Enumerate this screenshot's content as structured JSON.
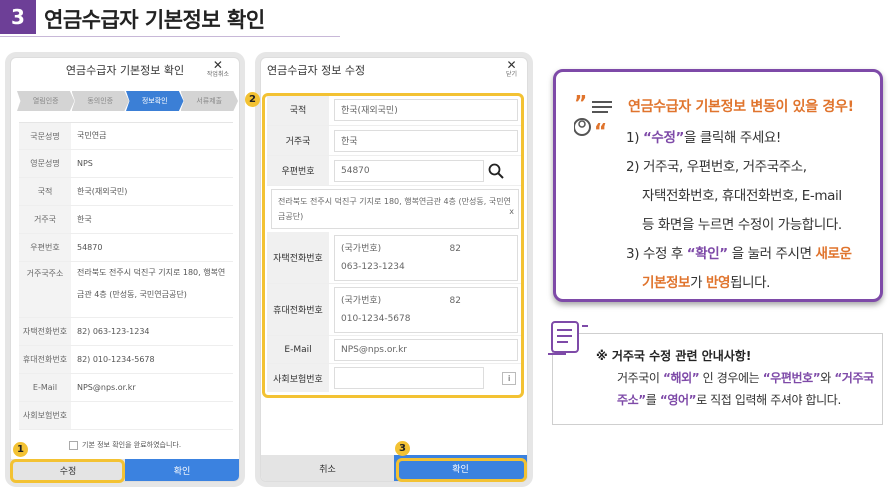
{
  "header": {
    "step_number": "3",
    "title": "연금수급자 기본정보 확인"
  },
  "screen1": {
    "title": "연금수급자 기본정보 확인",
    "close_label": "작업취소",
    "steps": [
      "열림인증",
      "동의인증",
      "정보확인",
      "서류제출"
    ],
    "rows": [
      {
        "label": "국문성명",
        "value": "국민연금"
      },
      {
        "label": "영문성명",
        "value": "NPS"
      },
      {
        "label": "국적",
        "value": "한국(재외국민)"
      },
      {
        "label": "거주국",
        "value": "한국"
      },
      {
        "label": "우편번호",
        "value": "54870"
      },
      {
        "label": "거주국주소",
        "value": "전라북도 전주시 덕진구 기지로 180, 행복연금관 4층 (만성동, 국민연금공단)"
      },
      {
        "label": "자택전화번호",
        "value": "82) 063-123-1234"
      },
      {
        "label": "휴대전화번호",
        "value": "82) 010-1234-5678"
      },
      {
        "label": "E-Mail",
        "value": "NPS@nps.or.kr"
      },
      {
        "label": "사회보험번호",
        "value": ""
      }
    ],
    "confirm_text": "기본 정보 확인을 완료하였습니다.",
    "edit_button": "수정",
    "ok_button": "확인"
  },
  "screen2": {
    "title": "연금수급자 정보 수정",
    "close_label": "닫기",
    "nationality_label": "국적",
    "nationality_value": "한국(재외국민)",
    "country_label": "거주국",
    "country_value": "한국",
    "zip_label": "우편번호",
    "zip_value": "54870",
    "address_value": "전라북도 전주시 덕진구 기지로 180, 행복연금관 4층 (만성동, 국민연금공단)",
    "home_phone_label": "자택전화번호",
    "home_phone_code_label": "(국가번호)",
    "home_phone_code": "82",
    "home_phone_value": "063-123-1234",
    "mobile_label": "휴대전화번호",
    "mobile_code_label": "(국가번호)",
    "mobile_code": "82",
    "mobile_value": "010-1234-5678",
    "email_label": "E-Mail",
    "email_value": "NPS@nps.or.kr",
    "ssn_label": "사회보험번호",
    "cancel_button": "취소",
    "ok_button": "확인"
  },
  "markers": [
    "1",
    "2",
    "3"
  ],
  "info_panel": {
    "heading": "연금수급자 기본정보 변동이 있을 경우!",
    "line1_pre": "1) ",
    "line1_hl": "“수정”",
    "line1_post": "을 클릭해 주세요!",
    "line2": "2) 거주국, 우편번호, 거주국주소,",
    "line3": "자택전화번호, 휴대전화번호, E-mail",
    "line4": "등 화면을 누르면 수정이 가능합니다.",
    "line5_pre": "3) 수정 후 ",
    "line5_hl": "“확인”",
    "line5_mid": " 을 눌러 주시면 ",
    "line5_hl2": "새로운",
    "line6_hl": "기본정보",
    "line6_mid": "가 ",
    "line6_hl2": "반영",
    "line6_post": "됩니다."
  },
  "note_panel": {
    "heading": "※ 거주국 수정 관련 안내사항!",
    "t1": "거주국이 ",
    "t1_hl": "“해외”",
    "t2": " 인 경우에는 ",
    "t2_hl": "“우편번호”",
    "t3": "와 ",
    "t3_hl": "“거주국",
    "t4_hl": "주소”",
    "t4": "를 ",
    "t4_hl2": "“영어”",
    "t5": "로 직접 입력해 주셔야 합니다."
  },
  "colors": {
    "accent_purple": "#7e4aa8",
    "accent_orange": "#e0742d",
    "highlight_yellow": "#f3c233",
    "button_blue": "#3b82e0"
  }
}
